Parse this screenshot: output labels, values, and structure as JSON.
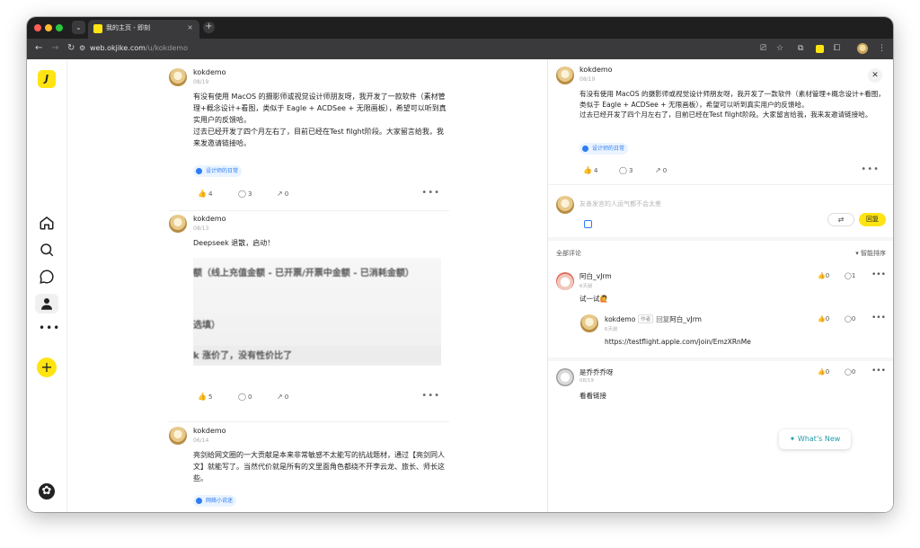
{
  "browser": {
    "tab_title": "我的主页 - 即刻",
    "tab_close": "×",
    "new_tab": "+",
    "url_host": "web.okjike.com",
    "url_path": "/u/kokdemo"
  },
  "feed": {
    "posts": [
      {
        "author": "kokdemo",
        "date": "08/19",
        "text": "有没有使用 MacOS 的摄影师或视觉设计师朋友呀，我开发了一款软件（素材管理+概念设计+看图，类似于 Eagle + ACDSee + 无限画板），希望可以听到真实用户的反馈哈。\n过去已经开发了四个月左右了，目前已经在Test filght阶段。大家留言给我，我来发邀请链接哈。",
        "topic": "设计师的日常",
        "likes": "4",
        "comments": "3",
        "shares": "0"
      },
      {
        "author": "kokdemo",
        "date": "08/13",
        "text": "Deepseek 退散，启动！",
        "image_lines": [
          "额（线上充值金额 - 已开票/开票中金额 - 已消耗金额）",
          "选填）",
          "k 涨价了，没有性价比了"
        ],
        "likes": "5",
        "comments": "0",
        "shares": "0"
      },
      {
        "author": "kokdemo",
        "date": "06/14",
        "text": "亮剑给网文圈的一大贡献是本来非常敏感不太能写的抗战题材，通过【亮剑同人文】就能写了。当然代价就是所有的文里面角色都绕不开李云龙、旅长、师长这些。",
        "topic": "网络小说迷"
      }
    ]
  },
  "detail": {
    "author": "kokdemo",
    "date": "08/19",
    "text": "有没有使用 MacOS 的摄影师或视觉设计师朋友呀，我开发了一款软件（素材管理+概念设计+看图，类似于 Eagle + ACDSee + 无限画板），希望可以听到真实用户的反馈哈。\n过去已经开发了四个月左右了，目前已经在Test filght阶段。大家留言给我，我来发邀请链接哈。",
    "topic": "设计师的日常",
    "likes": "4",
    "comments": "3",
    "shares": "0",
    "comment_placeholder": "友善发言的人运气都不会太差",
    "reply_label": "回复",
    "all_comments_label": "全部评论",
    "sort_label": "智能排序",
    "comments_list": [
      {
        "name": "阿白_vJrm",
        "date": "6天前",
        "text": "试一试🙋",
        "likes": "0",
        "replies": "1"
      },
      {
        "name": "kokdemo",
        "badge": "作者",
        "reply_word": "回复",
        "reply_to": "阿白_vJrm",
        "date": "6天前",
        "text": "https://testflight.apple.com/join/EmzXRnMe",
        "likes": "0",
        "replies": "0"
      },
      {
        "name": "是乔乔乔呀",
        "date": "08/19",
        "text": "看看链接",
        "likes": "0",
        "replies": "0"
      }
    ]
  },
  "whats_new": "What's New",
  "colors": {
    "brand": "#ffe411",
    "topic_blue": "#2e7cf6",
    "whats_new": "#1f9aa7"
  },
  "icons": [
    "home-icon",
    "search-icon",
    "message-icon",
    "profile-icon",
    "more-icon",
    "plus-icon",
    "settings-icon",
    "like-icon",
    "comment-icon",
    "share-icon",
    "close-icon"
  ]
}
